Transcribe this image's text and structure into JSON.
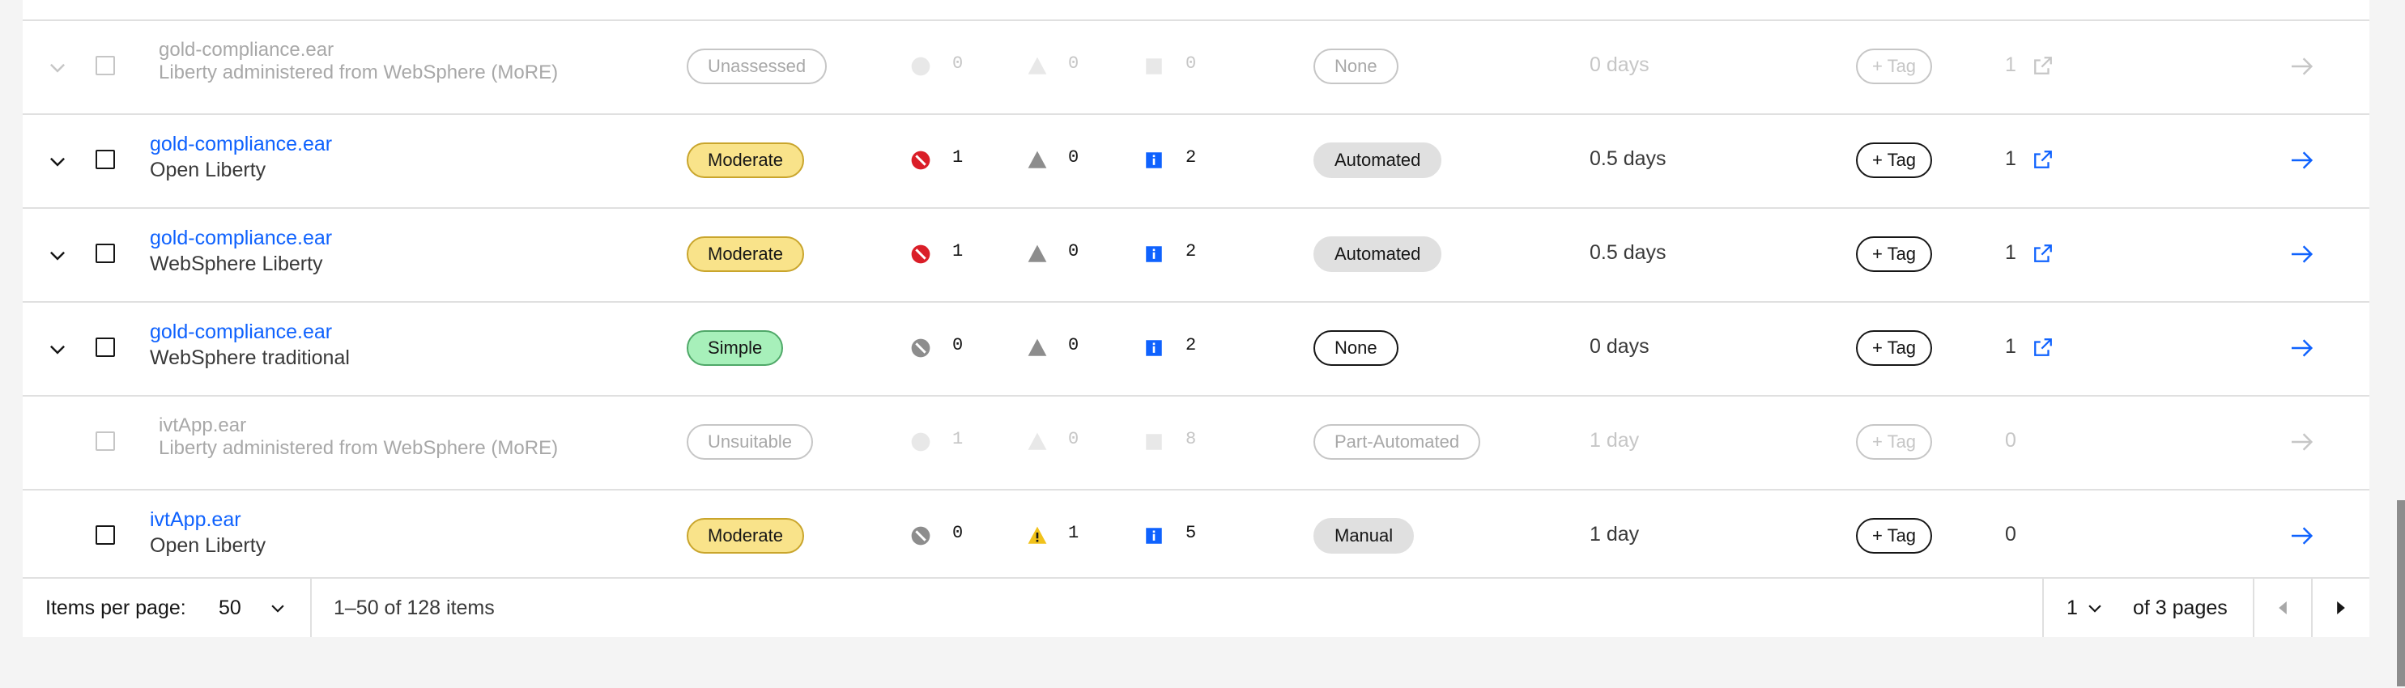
{
  "rows": [
    {
      "name": "gold-compliance.ear",
      "target": "Liberty administered from WebSphere (MoRE)",
      "complexity": "Unassessed",
      "critical": "0",
      "warning": "0",
      "info": "0",
      "effort": "None",
      "days": "0 days",
      "tag": "+ Tag",
      "count": "1",
      "disabled": true
    },
    {
      "name": "gold-compliance.ear",
      "target": "Open Liberty",
      "complexity": "Moderate",
      "critical": "1",
      "warning": "0",
      "info": "2",
      "effort": "Automated",
      "days": "0.5 days",
      "tag": "+ Tag",
      "count": "1"
    },
    {
      "name": "gold-compliance.ear",
      "target": "WebSphere Liberty",
      "complexity": "Moderate",
      "critical": "1",
      "warning": "0",
      "info": "2",
      "effort": "Automated",
      "days": "0.5 days",
      "tag": "+ Tag",
      "count": "1"
    },
    {
      "name": "gold-compliance.ear",
      "target": "WebSphere traditional",
      "complexity": "Simple",
      "critical": "0",
      "warning": "0",
      "info": "2",
      "effort": "None",
      "days": "0 days",
      "tag": "+ Tag",
      "count": "1"
    },
    {
      "name": "ivtApp.ear",
      "target": "Liberty administered from WebSphere (MoRE)",
      "complexity": "Unsuitable",
      "critical": "1",
      "warning": "0",
      "info": "8",
      "effort": "Part-Automated",
      "days": "1 day",
      "tag": "+ Tag",
      "count": "0",
      "disabled": true
    },
    {
      "name": "ivtApp.ear",
      "target": "Open Liberty",
      "complexity": "Moderate",
      "critical": "0",
      "warning": "1",
      "info": "5",
      "effort": "Manual",
      "days": "1 day",
      "tag": "+ Tag",
      "count": "0"
    }
  ],
  "pagination": {
    "items_per_page_label": "Items per page:",
    "items_per_page_value": "50",
    "range_text": "1–50 of 128 items",
    "current_page": "1",
    "total_pages_text": "of 3 pages"
  },
  "colors": {
    "link": "#0f62fe",
    "critical": "#da1e28",
    "warning_inactive": "#8d8d8d",
    "warning_active": "#f1c21b",
    "info": "#0f62fe",
    "moderate": "#f9e38a",
    "simple": "#a7f0ba"
  }
}
